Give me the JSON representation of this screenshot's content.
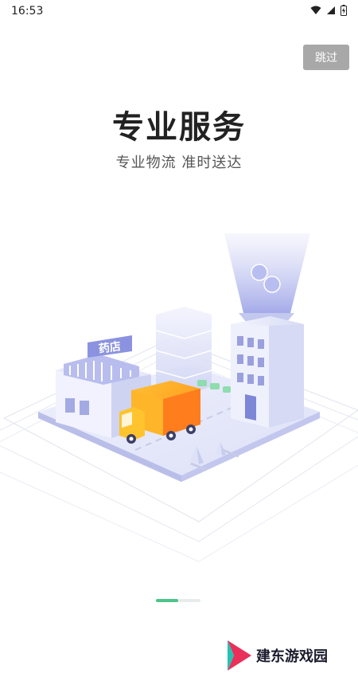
{
  "status_bar": {
    "time": "16:53"
  },
  "skip_label": "跳过",
  "title": "专业服务",
  "subtitle": "专业物流 准时送达",
  "illustration": {
    "sign_text": "药店"
  },
  "pager": {
    "current": 1,
    "total": 2
  },
  "watermark": {
    "text": "建东游戏园"
  },
  "colors": {
    "accent": "#4cc48a",
    "truck": "#ffb21f",
    "building": "#dfe2f7"
  }
}
